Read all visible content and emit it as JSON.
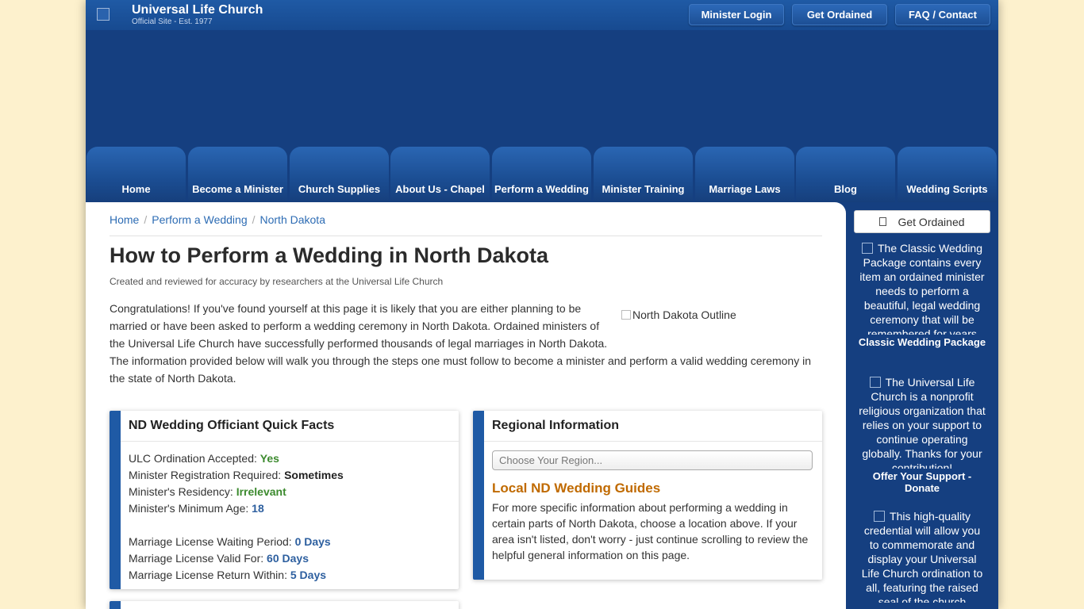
{
  "header": {
    "site_title": "Universal Life Church",
    "site_subtitle": "Official Site - Est. 1977",
    "buttons": [
      "Minister Login",
      "Get Ordained",
      "FAQ / Contact"
    ]
  },
  "nav": {
    "tabs": [
      "Home",
      "Become a Minister",
      "Church Supplies",
      "About Us - Chapel",
      "Perform a Wedding",
      "Minister Training",
      "Marriage Laws",
      "Blog",
      "Wedding Scripts"
    ]
  },
  "breadcrumb": [
    "Home",
    "Perform a Wedding",
    "North Dakota"
  ],
  "page": {
    "title": "How to Perform a Wedding in North Dakota",
    "byline": "Created and reviewed for accuracy by researchers at the Universal Life Church",
    "intro": "Congratulations! If you've found yourself at this page it is likely that you are either planning to be married or have been asked to perform a wedding ceremony in North Dakota. Ordained ministers of the Universal Life Church have successfully performed thousands of legal marriages in North Dakota. The information provided below will walk you through the steps one must follow to become a minister and perform a valid wedding ceremony in the state of North Dakota.",
    "image_alt": "North Dakota Outline"
  },
  "quick_facts": {
    "title": "ND Wedding Officiant Quick Facts",
    "items": [
      {
        "label": "ULC Ordination Accepted:",
        "value": "Yes"
      },
      {
        "label": "Minister Registration Required:",
        "value": "Sometimes"
      },
      {
        "label": "Minister's Residency:",
        "value": "Irrelevant"
      },
      {
        "label": "Minister's Minimum Age:",
        "value": "18"
      },
      {
        "label": "Marriage License Waiting Period:",
        "value": "0 Days"
      },
      {
        "label": "Marriage License Valid For:",
        "value": "60 Days"
      },
      {
        "label": "Marriage License Return Within:",
        "value": "5 Days"
      }
    ]
  },
  "regional": {
    "title": "Regional Information",
    "select_placeholder": "Choose Your Region...",
    "guides_title": "Local ND Wedding Guides",
    "guides_text": "For more specific information about performing a wedding in certain parts of North Dakota, choose a location above. If your area isn't listed, don't worry - just continue scrolling to review the helpful general information on this page."
  },
  "sidebar": {
    "button": "Get Ordained",
    "promos": [
      {
        "desc": "The Classic Wedding Package contains every item an ordained minister needs to perform a beautiful, legal wedding ceremony that will be remembered for years",
        "caption": "Classic Wedding Package"
      },
      {
        "desc": "The Universal Life Church is a nonprofit religious organization that relies on your support to continue operating globally. Thanks for your contribution!",
        "caption": "Offer Your Support - Donate"
      },
      {
        "desc": "This high-quality credential will allow you to commemorate and display your Universal Life Church ordination to all, featuring the raised seal of the church",
        "caption": ""
      }
    ]
  },
  "colors": {
    "page_bg": "#fdf1cd",
    "brand_blue": "#153f80",
    "accent_orange": "#c06a00",
    "value_green": "#3c8a2e"
  }
}
